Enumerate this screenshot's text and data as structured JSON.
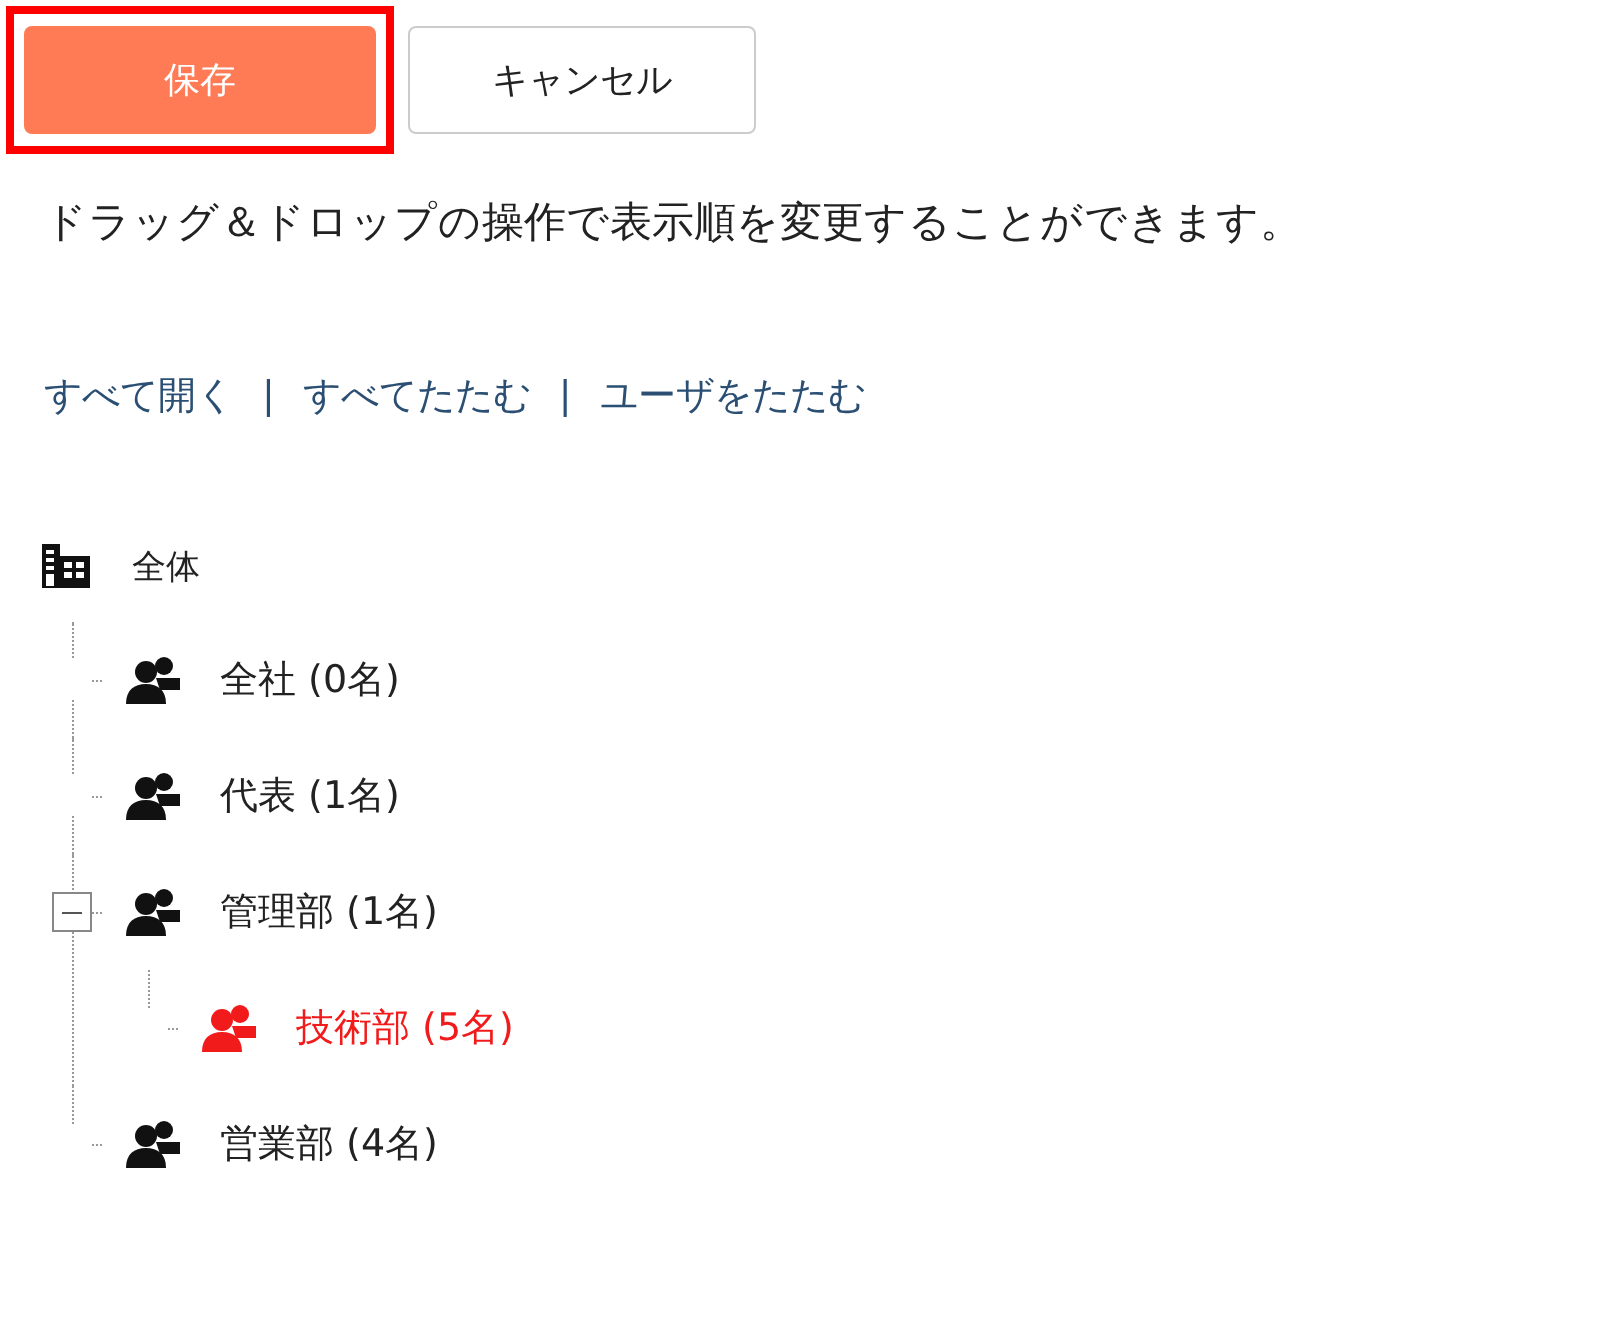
{
  "buttons": [
    {
      "kind": "primary",
      "label": "保存",
      "highlighted": true
    },
    {
      "kind": "secondary",
      "label": "キャンセル",
      "highlighted": false
    }
  ],
  "description": "ドラッグ＆ドロップの操作で表示順を変更することができます。",
  "links": [
    "すべて開く",
    "すべてたたむ",
    "ユーザをたたむ"
  ],
  "link_separator": "|",
  "tree": {
    "label": "全体",
    "kind": "organization",
    "children": [
      {
        "label": "全社 (0名)",
        "kind": "group",
        "selected": false
      },
      {
        "label": "代表 (1名)",
        "kind": "group",
        "selected": false
      },
      {
        "label": "管理部 (1名)",
        "kind": "group",
        "selected": false,
        "expanded": true,
        "children": [
          {
            "label": "技術部 (5名)",
            "kind": "group",
            "selected": true
          }
        ]
      },
      {
        "label": "営業部 (4名)",
        "kind": "group",
        "selected": false
      }
    ]
  }
}
